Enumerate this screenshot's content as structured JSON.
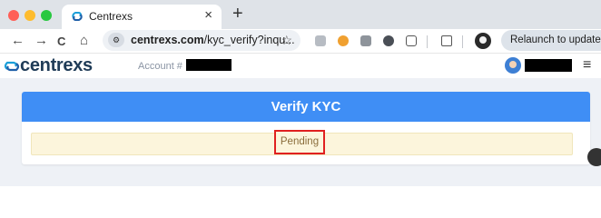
{
  "browser": {
    "tab": {
      "title": "Centrexs",
      "close_glyph": "×"
    },
    "new_tab_glyph": "+",
    "nav": {
      "back": "←",
      "forward": "→",
      "reload": "C",
      "home": "⌂"
    },
    "omnibox": {
      "url_host": "centrexs.com",
      "url_path": "/kyc_verify?inqu...",
      "tune_glyph": "⚙",
      "bookmark_glyph": "☆"
    },
    "relaunch_label": "Relaunch to update"
  },
  "site": {
    "logo_text": "centrexs",
    "account_label": "Account #",
    "menu_glyph": "≡"
  },
  "kyc": {
    "title": "Verify KYC",
    "status": "Pending"
  },
  "colors": {
    "header_blue": "#3f8ef5",
    "alert_bg": "#fcf5dc",
    "status_text": "#8a6d3b",
    "highlight_border": "#e02020"
  },
  "icons": [
    "chrome-favicon",
    "extension-icons",
    "profile-avatar",
    "centrexs-logo-icon",
    "user-avatar",
    "hamburger-icon"
  ]
}
